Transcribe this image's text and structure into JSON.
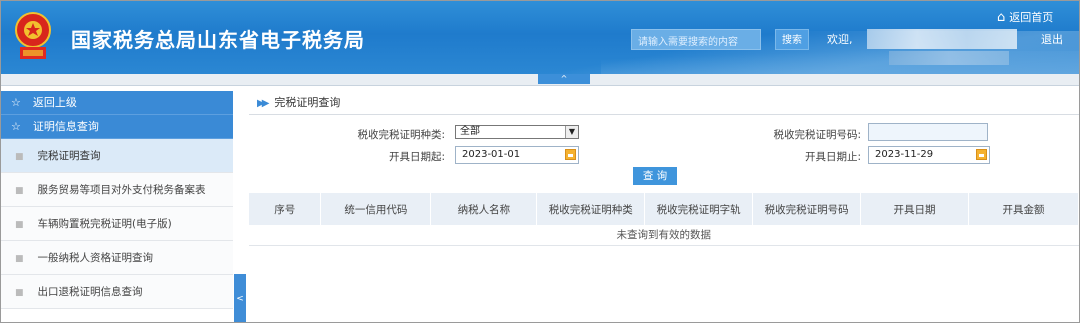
{
  "header": {
    "site_title": "国家税务总局山东省电子税务局",
    "search_placeholder": "请输入需要搜索的内容",
    "search_button": "搜索",
    "welcome": "欢迎,",
    "home_link": "返回首页",
    "logout": "退出",
    "toggle_glyph": "^"
  },
  "sidebar": {
    "back": "返回上级",
    "section": "证明信息查询",
    "items": [
      {
        "label": "完税证明查询",
        "active": true
      },
      {
        "label": "服务贸易等项目对外支付税务备案表",
        "active": false
      },
      {
        "label": "车辆购置税完税证明(电子版)",
        "active": false
      },
      {
        "label": "一般纳税人资格证明查询",
        "active": false
      },
      {
        "label": "出口退税证明信息查询",
        "active": false
      }
    ],
    "collapse_glyph": "<"
  },
  "main": {
    "breadcrumb": "完税证明查询",
    "form": {
      "type_label": "税收完税证明种类:",
      "type_value": "全部",
      "number_label": "税收完税证明号码:",
      "number_value": "",
      "start_label": "开具日期起:",
      "start_value": "2023-01-01",
      "end_label": "开具日期止:",
      "end_value": "2023-11-29",
      "query_button": "查 询"
    },
    "table": {
      "columns": [
        "序号",
        "统一信用代码",
        "纳税人名称",
        "税收完税证明种类",
        "税收完税证明字轨",
        "税收完税证明号码",
        "开具日期",
        "开具金额"
      ],
      "empty_message": "未查询到有效的数据"
    }
  },
  "colors": {
    "header_blue": "#2f8fd8",
    "sidebar_header": "#3a8ad6",
    "active_item": "#dbeaf8",
    "table_header": "#e9eff6",
    "calendar_icon": "#f5b230"
  }
}
